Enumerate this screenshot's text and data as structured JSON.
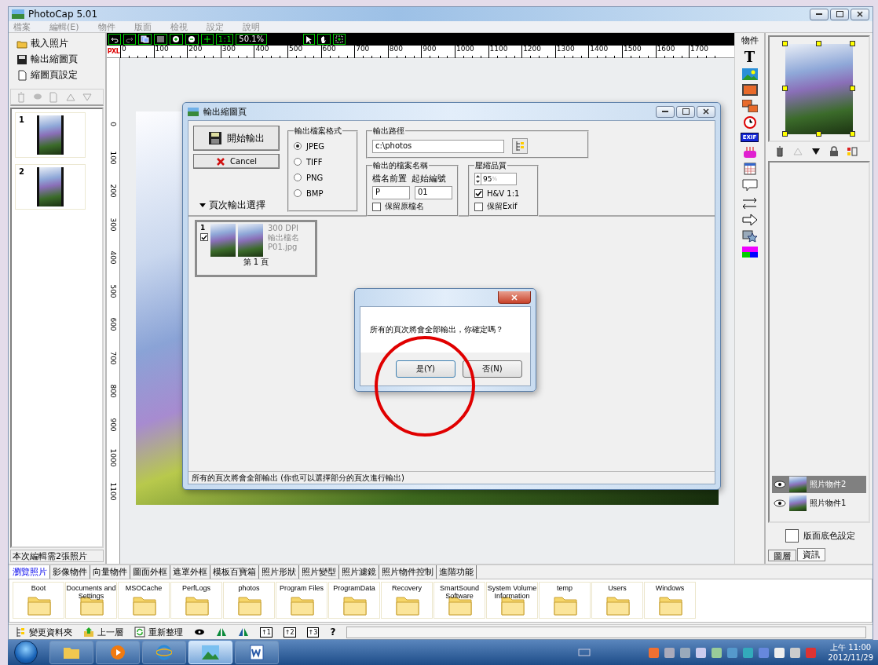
{
  "window": {
    "title": "PhotoCap 5.01"
  },
  "menu": [
    "檔案",
    "編輯(E)",
    "物件",
    "版面",
    "檢視",
    "設定",
    "說明"
  ],
  "left_panel": {
    "actions": [
      "載入照片",
      "輸出縮圖頁",
      "縮圖頁設定"
    ],
    "pages": [
      {
        "number": "1"
      },
      {
        "number": "2"
      }
    ],
    "status": "本次編輯需2張照片"
  },
  "canvas": {
    "actual_size": "1:1",
    "zoom": "50.1%",
    "ruler_unit": "PXL",
    "ruler_h": [
      "0",
      "100",
      "200",
      "300",
      "400",
      "500",
      "600",
      "700",
      "800",
      "900",
      "1000",
      "1100",
      "1200",
      "1300",
      "1400",
      "1500",
      "1600",
      "1700"
    ],
    "ruler_v": [
      "0",
      "100",
      "200",
      "300",
      "400",
      "500",
      "600",
      "700",
      "800",
      "900",
      "1000",
      "1100"
    ]
  },
  "tools": {
    "title": "物件",
    "text_tool": "T",
    "exif_label": "EXIF"
  },
  "right_panel": {
    "layers": [
      {
        "name": "照片物件2",
        "selected": true
      },
      {
        "name": "照片物件1",
        "selected": false
      }
    ],
    "background_option": {
      "label": "版面底色設定",
      "checked": false
    },
    "tabs": [
      {
        "label": "圖層",
        "selected": true
      },
      {
        "label": "資訊",
        "selected": false
      }
    ]
  },
  "bottom_tabs": [
    {
      "label": "瀏覽照片",
      "selected": true
    },
    {
      "label": "影像物件",
      "selected": false
    },
    {
      "label": "向量物件",
      "selected": false
    },
    {
      "label": "圖面外框",
      "selected": false
    },
    {
      "label": "遮罩外框",
      "selected": false
    },
    {
      "label": "模板百寶箱",
      "selected": false
    },
    {
      "label": "照片形狀",
      "selected": false
    },
    {
      "label": "照片變型",
      "selected": false
    },
    {
      "label": "照片濾鏡",
      "selected": false
    },
    {
      "label": "照片物件控制",
      "selected": false
    },
    {
      "label": "進階功能",
      "selected": false
    }
  ],
  "folders": [
    "Boot",
    "Documents and Settings",
    "MSOCache",
    "PerfLogs",
    "photos",
    "Program Files",
    "ProgramData",
    "Recovery",
    "SmartSound Software",
    "System Volume Information",
    "temp",
    "Users",
    "Windows"
  ],
  "bottom_toolbar": {
    "actions": [
      "變更資料夾",
      "上一層",
      "重新整理"
    ],
    "levels": [
      "↑1",
      "↑2",
      "↑3"
    ],
    "help": "?"
  },
  "export_dialog": {
    "title": "輸出縮圖頁",
    "start_button": "開始輸出",
    "cancel_button": "Cancel",
    "format_group": "輸出檔案格式",
    "formats": [
      {
        "label": "JPEG",
        "selected": true
      },
      {
        "label": "TIFF",
        "selected": false
      },
      {
        "label": "PNG",
        "selected": false
      },
      {
        "label": "BMP",
        "selected": false
      }
    ],
    "path_group": "輸出路徑",
    "path": "c:\\photos",
    "name_group": "輸出的檔案名稱",
    "prefix_label": "檔名前置",
    "start_number_label": "起始編號",
    "prefix": "P",
    "start_number": "01",
    "keep_name": {
      "label": "保留原檔名",
      "checked": false
    },
    "quality_group": "壓縮品質",
    "quality": "95",
    "quality_unit": "%",
    "quality_options": [
      {
        "label": "H&V 1:1",
        "checked": true
      },
      {
        "label": "保留Exif",
        "checked": false
      }
    ],
    "page_select": "頁次輸出選擇",
    "pages": [
      {
        "number": "1",
        "checked": true,
        "dpi": "300 DPI",
        "file_label": "輸出檔名",
        "file": "P01.jpg",
        "caption": "第 1 頁"
      }
    ],
    "status": "所有的頁次將會全部輸出 (你也可以選擇部分的頁次進行輸出)"
  },
  "confirm_dialog": {
    "message": "所有的頁次將會全部輸出，你確定嗎？",
    "yes": "是(Y)",
    "no": "否(N)"
  },
  "taskbar": {
    "time": "上午 11:00",
    "date": "2012/11/29"
  }
}
